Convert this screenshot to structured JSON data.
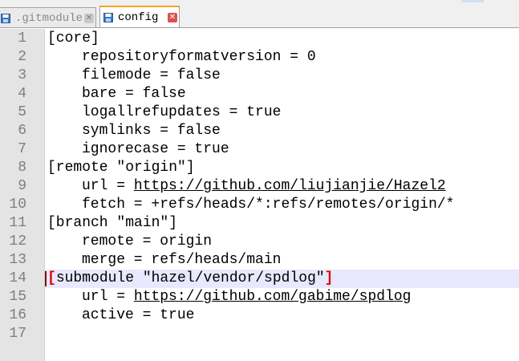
{
  "tabs": [
    {
      "label": ".gitmodules",
      "active": false
    },
    {
      "label": "config",
      "active": true
    }
  ],
  "tab_close_glyph": "✕",
  "colors": {
    "active_tab_accent": "#f5a623",
    "current_line_bg": "#e8e8ff",
    "brace_highlight": "#e00000",
    "gutter_bg": "#e4e4e4"
  },
  "current_line": 14,
  "editor": {
    "lines": [
      {
        "number": "1",
        "indent": false,
        "text": "[core]"
      },
      {
        "number": "2",
        "indent": true,
        "text": "repositoryformatversion = 0"
      },
      {
        "number": "3",
        "indent": true,
        "text": "filemode = false"
      },
      {
        "number": "4",
        "indent": true,
        "text": "bare = false"
      },
      {
        "number": "5",
        "indent": true,
        "text": "logallrefupdates = true"
      },
      {
        "number": "6",
        "indent": true,
        "text": "symlinks = false"
      },
      {
        "number": "7",
        "indent": true,
        "text": "ignorecase = true"
      },
      {
        "number": "8",
        "indent": false,
        "text": "[remote \"origin\"]"
      },
      {
        "number": "9",
        "indent": true,
        "prefix": "url = ",
        "link": "https://github.com/liujianjie/Hazel2"
      },
      {
        "number": "10",
        "indent": true,
        "text": "fetch = +refs/heads/*:refs/remotes/origin/*"
      },
      {
        "number": "11",
        "indent": false,
        "text": "[branch \"main\"]"
      },
      {
        "number": "12",
        "indent": true,
        "text": "remote = origin"
      },
      {
        "number": "13",
        "indent": true,
        "text": "merge = refs/heads/main"
      },
      {
        "number": "14",
        "indent": false,
        "open": "[",
        "text": "submodule \"hazel/vendor/spdlog\"",
        "close": "]"
      },
      {
        "number": "15",
        "indent": true,
        "prefix": "url = ",
        "link": "https://github.com/gabime/spdlog"
      },
      {
        "number": "16",
        "indent": true,
        "text": "active = true"
      },
      {
        "number": "17",
        "indent": false,
        "text": ""
      }
    ]
  }
}
